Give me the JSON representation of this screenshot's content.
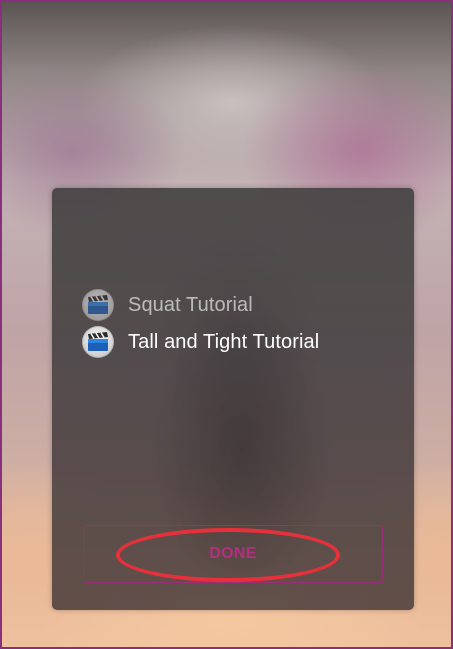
{
  "menu": {
    "items": [
      {
        "label": "Squat Tutorial",
        "icon": "clapperboard-icon",
        "state": "dimmed"
      },
      {
        "label": "Tall and Tight Tutorial",
        "icon": "clapperboard-icon",
        "state": "active"
      }
    ],
    "done_label": "DONE"
  },
  "colors": {
    "accent": "#b42f7f",
    "annotation": "#e8303a",
    "frame_border": "#8a2f7d"
  }
}
